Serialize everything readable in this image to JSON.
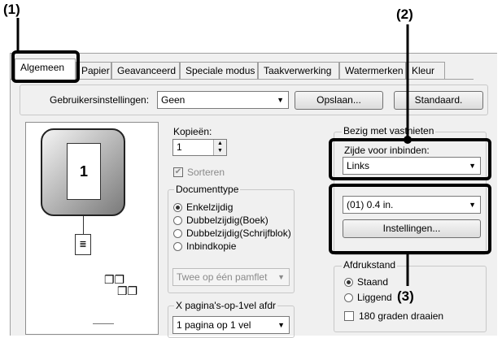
{
  "callouts": {
    "c1": "(1)",
    "c2": "(2)",
    "c3": "(3)"
  },
  "tabs": [
    {
      "label": "Algemeen",
      "active": true
    },
    {
      "label": "Papier"
    },
    {
      "label": "Geavanceerd"
    },
    {
      "label": "Speciale modus"
    },
    {
      "label": "Taakverwerking"
    },
    {
      "label": "Watermerken"
    },
    {
      "label": "Kleur"
    }
  ],
  "user_settings": {
    "label": "Gebruikersinstellingen:",
    "value": "Geen",
    "save": "Opslaan...",
    "default": "Standaard."
  },
  "preview": {
    "page_number": "1"
  },
  "copies": {
    "label": "Kopieën:",
    "value": "1",
    "sort_label": "Sorteren",
    "sort_checked": true
  },
  "doc_type": {
    "legend": "Documenttype",
    "options": [
      "Enkelzijdig",
      "Dubbelzijdig(Boek)",
      "Dubbelzijdig(Schrijfblok)",
      "Inbindkopie"
    ],
    "selected": 0,
    "pamphlet": "Twee op één pamflet"
  },
  "nup": {
    "legend": "X pagina's-op-1vel afdr",
    "value": "1 pagina op 1 vel"
  },
  "binding": {
    "legend": "Bezig met vastnieten",
    "side_label": "Zijde voor inbinden:",
    "side_value": "Links",
    "margin_value": "(01) 0.4 in.",
    "settings_button": "Instellingen..."
  },
  "orientation": {
    "legend": "Afdrukstand",
    "options": [
      "Staand",
      "Liggend"
    ],
    "selected": 0,
    "rotate_label": "180 graden draaien"
  }
}
